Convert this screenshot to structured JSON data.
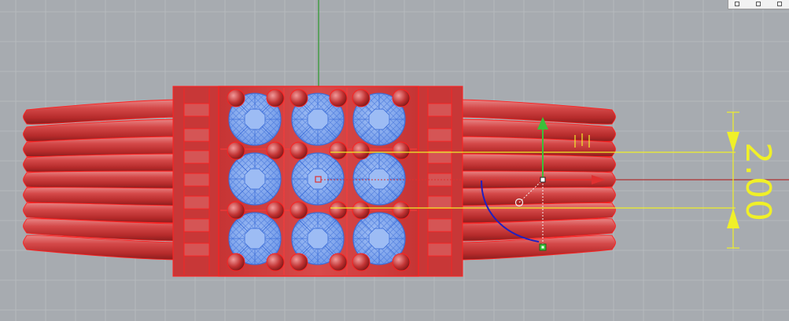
{
  "viewport": {
    "background": "#a7abb0",
    "grid_color": "#b8bcc0",
    "axis_x_color": "#b03030",
    "axis_y_color": "#2a9a2a"
  },
  "colors": {
    "band_red": "#cc3b3b",
    "band_highlight": "#e67a7a",
    "band_shadow": "#8e1f1f",
    "selection_outline": "#ff2020",
    "gem_blue": "#7fa6ee",
    "gem_wire": "#3d6ed8",
    "dimension_yellow": "#f0f028",
    "gumball_green": "#3ac03a",
    "gumball_red": "#e03030",
    "gumball_blue": "#2020c0"
  },
  "dimension": {
    "value": "2.00"
  },
  "mini_toolbar": {
    "icons": [
      "toolbar-icon-1",
      "toolbar-icon-2",
      "toolbar-icon-3"
    ]
  },
  "gumball": {
    "icons": [
      "move-x-arrow",
      "move-y-arrow",
      "rotate-arc",
      "scale-handle"
    ]
  }
}
